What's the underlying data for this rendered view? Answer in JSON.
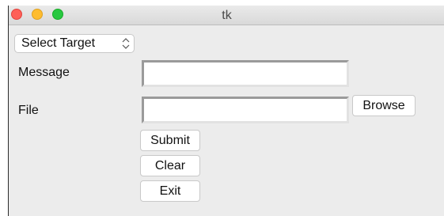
{
  "window": {
    "title": "tk"
  },
  "controls": {
    "target_select": {
      "value": "Select Target"
    },
    "message_label": "Message",
    "file_label": "File",
    "message_value": "",
    "file_value": "",
    "browse_label": "Browse",
    "submit_label": "Submit",
    "clear_label": "Clear",
    "exit_label": "Exit"
  }
}
